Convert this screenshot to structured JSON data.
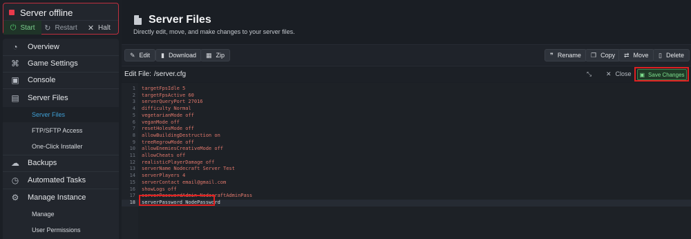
{
  "server": {
    "status": "Server offline",
    "status_color": "#e8394b",
    "buttons": {
      "start": "Start",
      "restart": "Restart",
      "halt": "Halt"
    }
  },
  "sidebar": {
    "items": [
      {
        "label": "Overview",
        "icon": "speedometer-icon"
      },
      {
        "label": "Game Settings",
        "icon": "gamepad-icon"
      },
      {
        "label": "Console",
        "icon": "terminal-icon"
      },
      {
        "label": "Server Files",
        "icon": "file-icon"
      },
      {
        "label": "Backups",
        "icon": "cloud-icon"
      },
      {
        "label": "Automated Tasks",
        "icon": "timer-icon"
      },
      {
        "label": "Manage Instance",
        "icon": "gear-icon"
      }
    ],
    "server_files_sub": [
      "Server Files",
      "FTP/SFTP Access",
      "One-Click Installer"
    ],
    "manage_sub": [
      "Manage",
      "User Permissions"
    ]
  },
  "page": {
    "title": "Server Files",
    "subtitle": "Directly edit, move, and make changes to your server files."
  },
  "toolbar": {
    "left": [
      "Edit",
      "Download",
      "Zip"
    ],
    "right": [
      "Rename",
      "Copy",
      "Move",
      "Delete"
    ]
  },
  "editor": {
    "label": "Edit File:",
    "filename": "/server.cfg",
    "close_label": "Close",
    "save_label": "Save Changes",
    "save_color": "#7fe08f",
    "lines": [
      "targetFpsIdle 5",
      "targetFpsActive 60",
      "serverQueryPort 27016",
      "difficulty Normal",
      "vegetarianMode off",
      "veganMode off",
      "resetHolesMode off",
      "allowBuildingDestruction on",
      "treeRegrowMode off",
      "allowEnemiesCreativeMode off",
      "allowCheats off",
      "realisticPlayerDamage off",
      "serverName Nodecraft Server Test",
      "serverPlayers 4",
      "serverContact email@gmail.com",
      "showLogs off",
      "serverPasswordAdmin NodecraftAdminPass",
      "serverPassword NodePassword"
    ],
    "active_line": 18
  }
}
